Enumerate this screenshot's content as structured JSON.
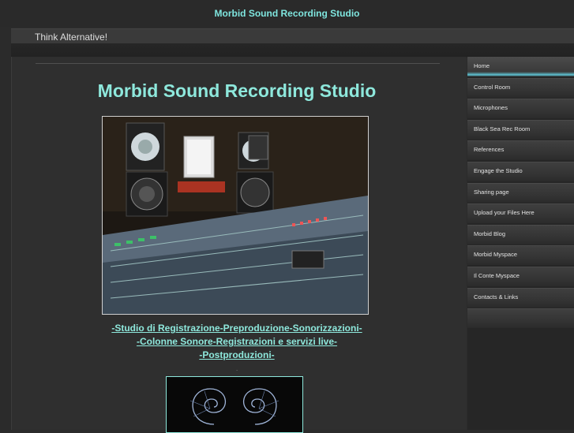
{
  "site": {
    "top_title": "Morbid Sound Recording Studio",
    "tagline": "Think Alternative!"
  },
  "main": {
    "heading": "Morbid Sound Recording Studio",
    "links": [
      "-Studio di Registrazione-Preproduzione-Sonorizzazioni-",
      "-Colonne Sonore-Registrazioni e servizi live-",
      "-Postproduzioni-"
    ],
    "separator_dot": "."
  },
  "sidebar": {
    "items": [
      {
        "label": "Home",
        "active": true
      },
      {
        "label": "Control Room"
      },
      {
        "label": "Microphones"
      },
      {
        "label": "Black Sea Rec Room"
      },
      {
        "label": "References"
      },
      {
        "label": "Engage the Studio"
      },
      {
        "label": "Sharing page"
      },
      {
        "label": "Upload your Files Here"
      },
      {
        "label": "Morbid Blog"
      },
      {
        "label": "Morbid Myspace"
      },
      {
        "label": "Il Conte Myspace"
      },
      {
        "label": "Contacts & Links"
      },
      {
        "label": ""
      }
    ]
  },
  "colors": {
    "accent": "#8ee8dc",
    "background": "#2b2b2b",
    "nav_active_bar": "#5fc6d6"
  }
}
